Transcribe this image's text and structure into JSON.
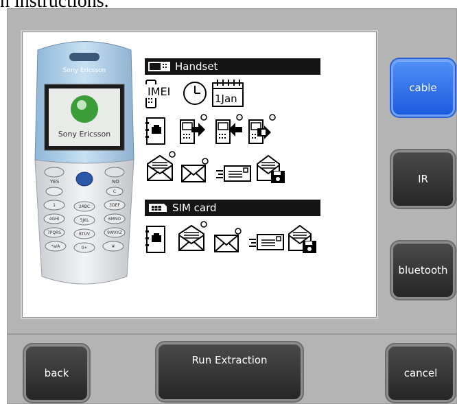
{
  "caption": "n instructions.",
  "phone": {
    "brand_top": "Sony Ericsson",
    "brand_screen": "Sony Ericsson",
    "keys": [
      "YES",
      "NO",
      "C",
      "1",
      "2ABC",
      "3DEF",
      "4GHI",
      "5JKL",
      "6MNO",
      "7PQRS",
      "8TUV",
      "9WXYZ",
      "*a/A",
      "0+",
      "#"
    ]
  },
  "sections": {
    "handset": "Handset",
    "sim": "SIM card"
  },
  "handset_icons": {
    "imei": "IMEI",
    "date": "1Jan"
  },
  "buttons": {
    "cable": "cable",
    "ir": "IR",
    "bluetooth": "bluetooth",
    "back": "back",
    "run": "Run Extraction",
    "cancel": "cancel"
  },
  "colors": {
    "active": "#2f6fe8",
    "frame": "#b4b4b4",
    "button": "#333333"
  }
}
